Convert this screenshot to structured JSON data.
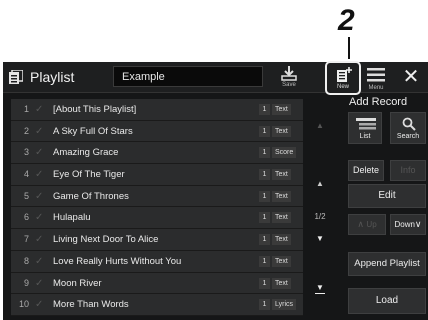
{
  "callout": {
    "step": "2"
  },
  "header": {
    "title": "Playlist",
    "name_value": "Example",
    "save_label": "Save",
    "new_label": "New",
    "menu_label": "Menu",
    "close_glyph": "✕"
  },
  "songs": [
    {
      "num": "1",
      "title": "[About This Playlist]",
      "count": "1",
      "type": "Text"
    },
    {
      "num": "2",
      "title": "A Sky Full Of Stars",
      "count": "1",
      "type": "Text"
    },
    {
      "num": "3",
      "title": "Amazing Grace",
      "count": "1",
      "type": "Score"
    },
    {
      "num": "4",
      "title": "Eye Of The Tiger",
      "count": "1",
      "type": "Text"
    },
    {
      "num": "5",
      "title": "Game Of Thrones",
      "count": "1",
      "type": "Text"
    },
    {
      "num": "6",
      "title": "Hulapalu",
      "count": "1",
      "type": "Text"
    },
    {
      "num": "7",
      "title": "Living Next Door To Alice",
      "count": "1",
      "type": "Text"
    },
    {
      "num": "8",
      "title": "Love Really Hurts Without You",
      "count": "1",
      "type": "Text"
    },
    {
      "num": "9",
      "title": "Moon River",
      "count": "1",
      "type": "Text"
    },
    {
      "num": "10",
      "title": "More Than Words",
      "count": "1",
      "type": "Lyrics"
    }
  ],
  "scroll": {
    "page": "1/2",
    "up_glyph": "▲",
    "down_glyph": "▼",
    "end_glyph": "▼"
  },
  "side": {
    "add_record": "Add Record",
    "list_label": "List",
    "search_label": "Search",
    "delete_label": "Delete",
    "info_label": "Info",
    "edit_label": "Edit",
    "up_label": "Up",
    "down_label": "Down",
    "append_label": "Append Playlist",
    "load_label": "Load"
  },
  "colors": {
    "background": "#151617",
    "row": "#2b2c2d",
    "button": "#2e2f30",
    "text": "#eaeaea"
  }
}
